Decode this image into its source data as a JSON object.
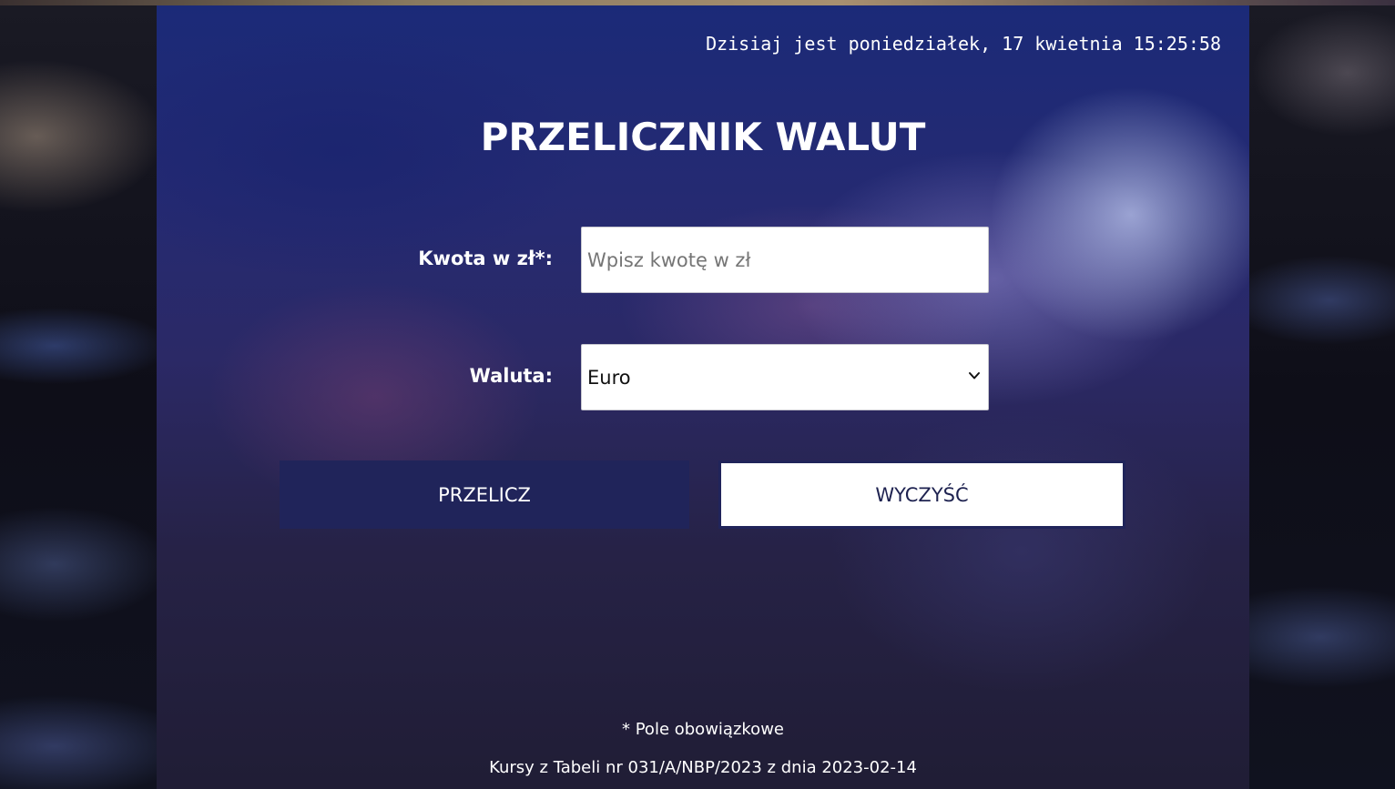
{
  "header": {
    "datetime": "Dzisiaj jest poniedziałek, 17 kwietnia 15:25:58"
  },
  "page": {
    "title": "PRZELICZNIK WALUT"
  },
  "form": {
    "amount_label": "Kwota w zł*:",
    "amount_placeholder": "Wpisz kwotę w zł",
    "amount_value": "",
    "currency_label": "Waluta:",
    "currency_selected": "Euro",
    "convert_label": "PRZELICZ",
    "clear_label": "WYCZYŚĆ"
  },
  "footer": {
    "required_note": "* Pole obowiązkowe",
    "rates_note": "Kursy z Tabeli nr 031/A/NBP/2023 z dnia 2023-02-14"
  },
  "icons": {
    "select_arrow": "chevron-down-icon"
  },
  "colors": {
    "convert_button_bg": "#20245a",
    "clear_button_bg": "#ffffff",
    "clear_button_text": "#1e2250"
  }
}
